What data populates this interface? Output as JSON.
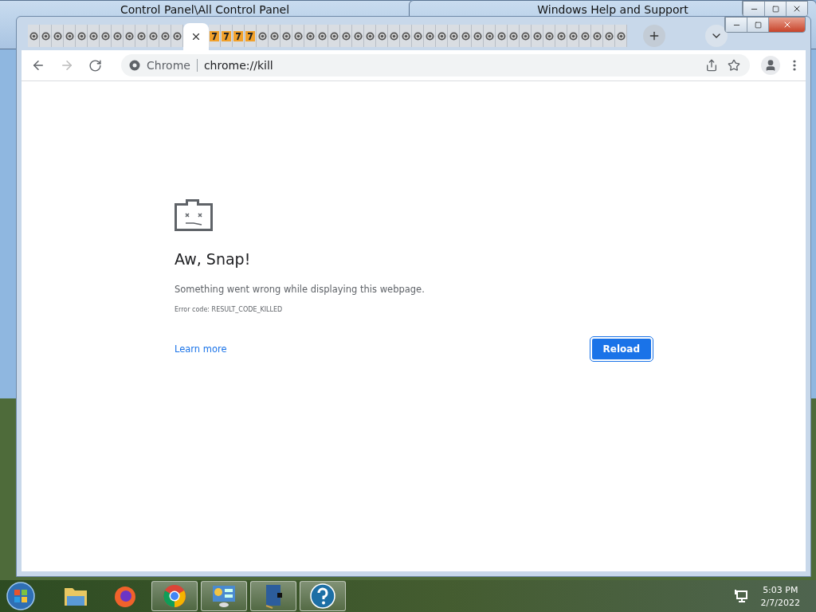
{
  "background_windows": [
    {
      "title": "Control Panel\\All Control Panel",
      "kind": "control"
    },
    {
      "title": "Windows Help and Support",
      "kind": "help"
    }
  ],
  "browser": {
    "tabs": [
      {
        "kind": "crashed",
        "selected": false
      },
      {
        "kind": "crashed",
        "selected": false
      },
      {
        "kind": "crashed",
        "selected": false
      },
      {
        "kind": "crashed",
        "selected": false
      },
      {
        "kind": "crashed",
        "selected": false
      },
      {
        "kind": "crashed",
        "selected": false
      },
      {
        "kind": "crashed",
        "selected": false
      },
      {
        "kind": "crashed",
        "selected": false
      },
      {
        "kind": "crashed",
        "selected": false
      },
      {
        "kind": "crashed",
        "selected": false
      },
      {
        "kind": "crashed",
        "selected": false
      },
      {
        "kind": "crashed",
        "selected": false
      },
      {
        "kind": "crashed",
        "selected": false
      },
      {
        "kind": "crashed",
        "selected": true
      },
      {
        "kind": "warning",
        "selected": false
      },
      {
        "kind": "warning",
        "selected": false
      },
      {
        "kind": "warning",
        "selected": false
      },
      {
        "kind": "warning",
        "selected": false
      },
      {
        "kind": "crashed",
        "selected": false
      },
      {
        "kind": "crashed",
        "selected": false
      },
      {
        "kind": "crashed",
        "selected": false
      },
      {
        "kind": "crashed",
        "selected": false
      },
      {
        "kind": "crashed",
        "selected": false
      },
      {
        "kind": "crashed",
        "selected": false
      },
      {
        "kind": "crashed",
        "selected": false
      },
      {
        "kind": "crashed",
        "selected": false
      },
      {
        "kind": "crashed",
        "selected": false
      },
      {
        "kind": "crashed",
        "selected": false
      },
      {
        "kind": "crashed",
        "selected": false
      },
      {
        "kind": "crashed",
        "selected": false
      },
      {
        "kind": "crashed",
        "selected": false
      },
      {
        "kind": "crashed",
        "selected": false
      },
      {
        "kind": "crashed",
        "selected": false
      },
      {
        "kind": "crashed",
        "selected": false
      },
      {
        "kind": "crashed",
        "selected": false
      },
      {
        "kind": "crashed",
        "selected": false
      },
      {
        "kind": "crashed",
        "selected": false
      },
      {
        "kind": "crashed",
        "selected": false
      },
      {
        "kind": "crashed",
        "selected": false
      },
      {
        "kind": "crashed",
        "selected": false
      },
      {
        "kind": "crashed",
        "selected": false
      },
      {
        "kind": "crashed",
        "selected": false
      },
      {
        "kind": "crashed",
        "selected": false
      },
      {
        "kind": "crashed",
        "selected": false
      },
      {
        "kind": "crashed",
        "selected": false
      },
      {
        "kind": "crashed",
        "selected": false
      },
      {
        "kind": "crashed",
        "selected": false
      },
      {
        "kind": "crashed",
        "selected": false
      },
      {
        "kind": "crashed",
        "selected": false
      }
    ],
    "omnibox": {
      "chip": "Chrome",
      "url": "chrome://kill"
    },
    "error_page": {
      "heading": "Aw, Snap!",
      "message": "Something went wrong while displaying this webpage.",
      "error_code": "Error code: RESULT_CODE_KILLED",
      "link": "Learn more",
      "button": "Reload"
    }
  },
  "taskbar": {
    "apps": [
      {
        "kind": "explorer",
        "open": false
      },
      {
        "kind": "firefox",
        "open": false
      },
      {
        "kind": "chrome",
        "open": true
      },
      {
        "kind": "control",
        "open": true
      },
      {
        "kind": "book",
        "open": true
      },
      {
        "kind": "help",
        "open": true
      }
    ],
    "time": "5:03 PM",
    "date": "2/7/2022"
  }
}
